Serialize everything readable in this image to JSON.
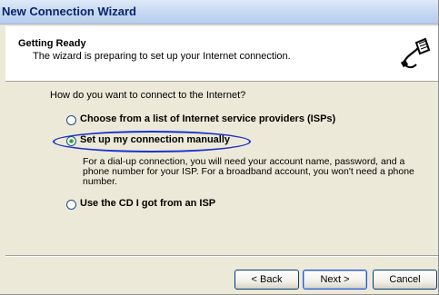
{
  "window": {
    "title": "New Connection Wizard"
  },
  "header": {
    "title": "Getting Ready",
    "subtitle": "The wizard is preparing to set up your Internet connection.",
    "icon": "network-plug-icon"
  },
  "question": "How do you want to connect to the Internet?",
  "options": [
    {
      "label": "Choose from a list of Internet service providers (ISPs)",
      "selected": false
    },
    {
      "label": "Set up my connection manually",
      "selected": true
    },
    {
      "label": "Use the CD I got from an ISP",
      "selected": false
    }
  ],
  "manual_description": "For a dial-up connection, you will need your account name, password, and a phone number for your ISP. For a broadband account, you won't need a phone number.",
  "buttons": {
    "back": "< Back",
    "next": "Next >",
    "cancel": "Cancel"
  },
  "colors": {
    "annotation_circle": "#1a33c9",
    "titlebar": "#c5d7f2",
    "dialog_bg": "#ece9d8"
  }
}
